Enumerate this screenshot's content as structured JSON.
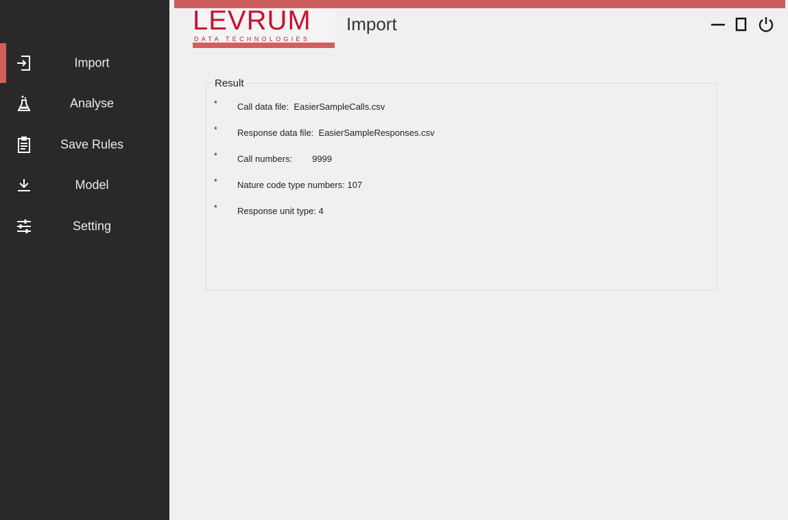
{
  "app": {
    "logo_text": "LEVRUM",
    "logo_subtitle": "DATA TECHNOLOGIES",
    "page_title": "Import",
    "accent_color": "#cd5c5c",
    "sidebar_color": "#2a2828"
  },
  "sidebar": {
    "items": [
      {
        "label": "Import",
        "icon": "import-icon",
        "active": true
      },
      {
        "label": "Analyse",
        "icon": "flask-icon",
        "active": false
      },
      {
        "label": "Save Rules",
        "icon": "clipboard-icon",
        "active": false
      },
      {
        "label": "Model",
        "icon": "download-icon",
        "active": false
      },
      {
        "label": "Setting",
        "icon": "sliders-icon",
        "active": false
      }
    ]
  },
  "window_controls": [
    "minimize-icon",
    "maximize-icon",
    "power-icon"
  ],
  "result": {
    "legend": "Result",
    "bullet": "*",
    "items": [
      "Call data file:  EasierSampleCalls.csv",
      "Response data file:  EasierSampleResponses.csv",
      "Call numbers:        9999",
      "Nature code type numbers: 107",
      "Response unit type: 4"
    ]
  }
}
